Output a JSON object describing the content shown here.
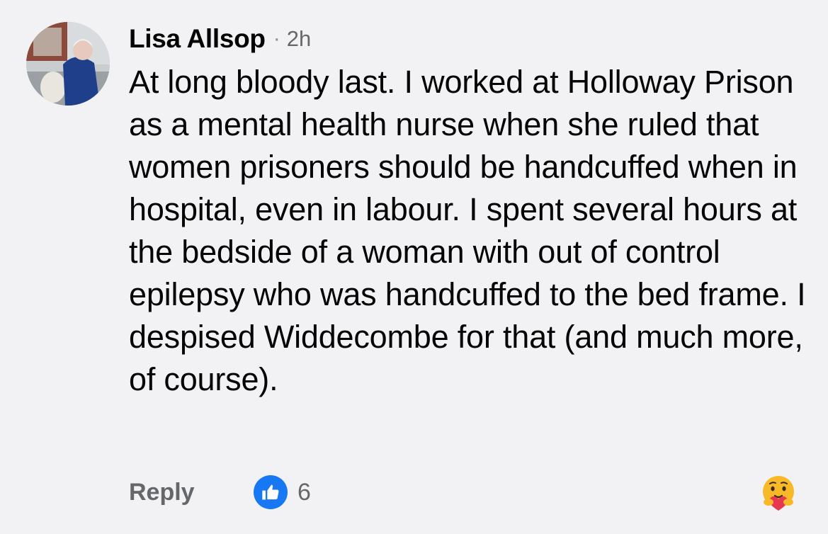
{
  "comment": {
    "author": "Lisa Allsop",
    "separator": "·",
    "time": "2h",
    "text": "At long bloody last. I worked at Holloway Prison as a mental health nurse when she ruled that women prisoners should be handcuffed when in hospital, even in labour. I spent several hours at the bedside of a woman with out of control epilepsy who was handcuffed to the bed frame. I despised Widdecombe for that (and much more, of course).",
    "avatar_icon": "profile-photo",
    "actions": {
      "reply_label": "Reply",
      "reaction_icon": "like-icon",
      "reaction_count": "6",
      "react_button_icon": "care-emoji-icon"
    }
  },
  "colors": {
    "background": "#f2f2f4",
    "like_blue": "#1877f2",
    "secondary_text": "#65676b",
    "primary_text": "#050505"
  }
}
